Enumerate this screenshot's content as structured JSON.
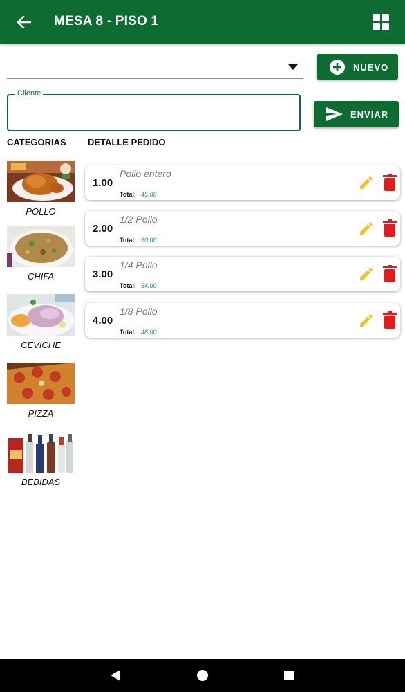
{
  "appbar": {
    "title": "MESA 8 - PISO 1",
    "back_icon": "arrow-left-icon",
    "view_icon": "grid-view-icon"
  },
  "form": {
    "select_value": "",
    "nuevo_label": "NUEVO",
    "cliente_label": "Cliente",
    "cliente_value": "",
    "enviar_label": "ENVIAR"
  },
  "sections": {
    "categorias": "CATEGORIAS",
    "detalle": "DETALLE PEDIDO"
  },
  "categories": [
    {
      "label": "POLLO",
      "image": "roast-chicken-image"
    },
    {
      "label": "CHIFA",
      "image": "fried-rice-image"
    },
    {
      "label": "CEVICHE",
      "image": "ceviche-image"
    },
    {
      "label": "PIZZA",
      "image": "pizza-image"
    },
    {
      "label": "BEBIDAS",
      "image": "bottles-image"
    }
  ],
  "order": {
    "total_label": "Total:",
    "items": [
      {
        "qty": "1.00",
        "name": "Pollo entero",
        "total": "45.00"
      },
      {
        "qty": "2.00",
        "name": "1/2 Pollo",
        "total": "60.00"
      },
      {
        "qty": "3.00",
        "name": "1/4 Pollo",
        "total": "54.00"
      },
      {
        "qty": "4.00",
        "name": "1/8 Pollo",
        "total": "48.00"
      }
    ]
  },
  "colors": {
    "primary": "#0e6b31",
    "edit": "#f2c12e",
    "delete": "#e51b1b",
    "total_value": "#1d9a50"
  }
}
